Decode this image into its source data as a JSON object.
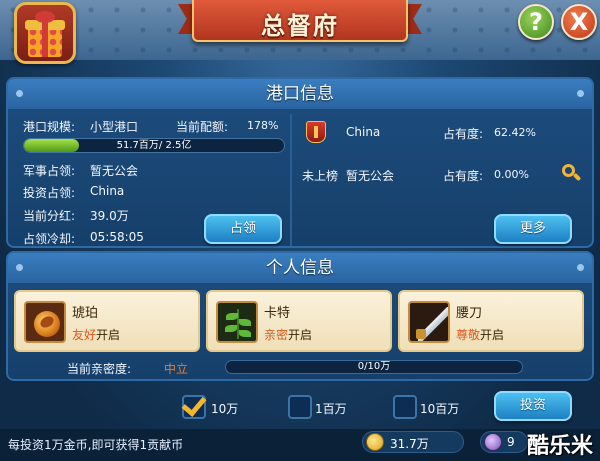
{
  "title": "总督府",
  "help_label": "?",
  "close_label": "X",
  "port_info": {
    "header": "港口信息",
    "size_label": "港口规模:",
    "size_value": "小型港口",
    "quota_label": "当前配额:",
    "quota_value": "178%",
    "progress_text": "51.7百万/ 2.5亿",
    "progress_fraction": 0.21,
    "military_label": "军事占领:",
    "military_value": "暂无公会",
    "investment_label": "投资占领:",
    "investment_value": "China",
    "dividend_label": "当前分红:",
    "dividend_value": "39.0万",
    "cooldown_label": "占领冷却:",
    "cooldown_value": "05:58:05",
    "occupy_button": "占领",
    "ranking": [
      {
        "rank_icon": "red-flag-rank-1-icon",
        "name": "China",
        "share_label": "占有度:",
        "share_value": "62.42%"
      },
      {
        "rank_text": "未上榜",
        "name": "暂无公会",
        "share_label": "占有度:",
        "share_value": "0.00%"
      }
    ],
    "more_button": "更多"
  },
  "personal_info": {
    "header": "个人信息",
    "cards": [
      {
        "icon": "amber-icon",
        "name": "琥珀",
        "tier": "友好",
        "status": "开启"
      },
      {
        "icon": "plant-icon",
        "name": "卡特",
        "tier": "亲密",
        "status": "开启"
      },
      {
        "icon": "sword-icon",
        "name": "腰刀",
        "tier": "尊敬",
        "status": "开启"
      }
    ],
    "intimacy_label": "当前亲密度:",
    "intimacy_level": "中立",
    "intimacy_progress": "0/10万"
  },
  "invest": {
    "options": [
      {
        "label": "10万",
        "checked": true
      },
      {
        "label": "1百万",
        "checked": false
      },
      {
        "label": "10百万",
        "checked": false
      }
    ],
    "button": "投资"
  },
  "footer": {
    "note": "每投资1万金币,即可获得1贡献币",
    "coins": "31.7万",
    "gems": "9",
    "watermark": "酷乐米"
  },
  "colors": {
    "accent_orange": "#e0581a",
    "button_blue": "#1d7fc4",
    "progress_green": "#7cc62e"
  }
}
